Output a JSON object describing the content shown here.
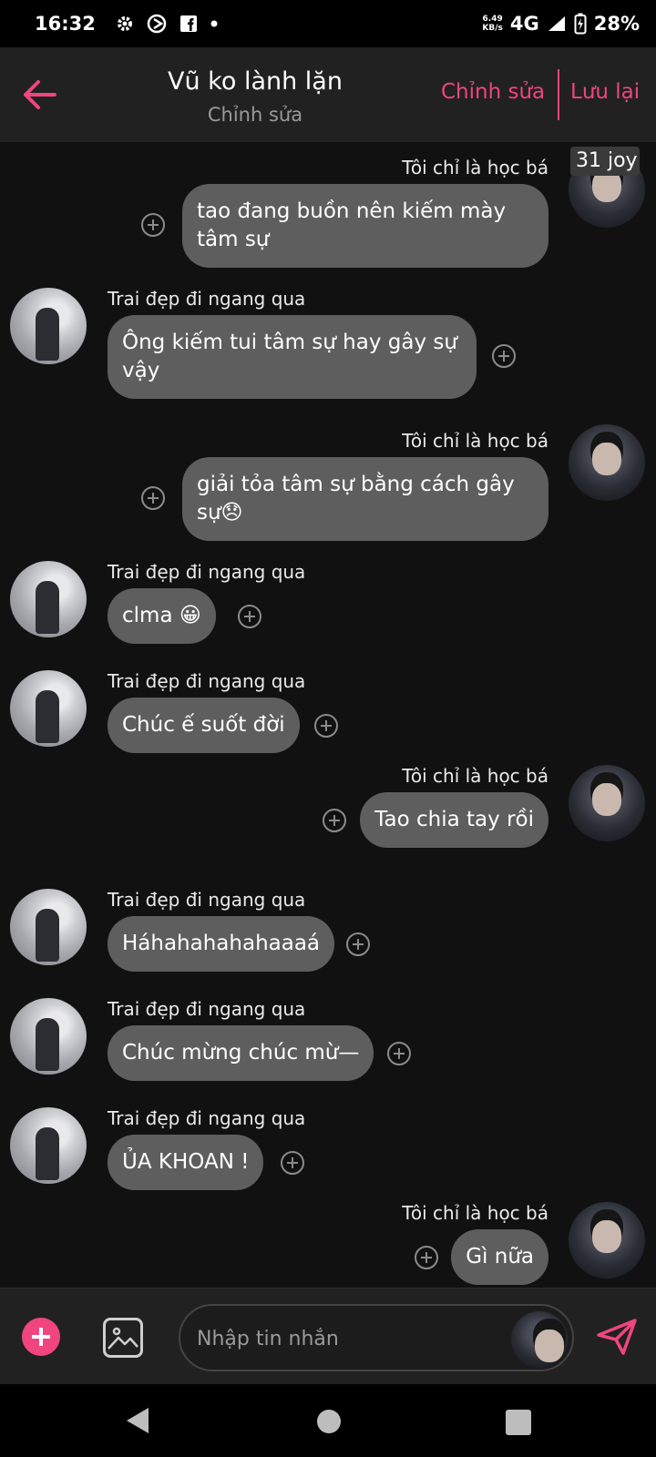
{
  "status_bar": {
    "time": "16:32",
    "network_speed_value": "6.49",
    "network_speed_unit": "KB/s",
    "network": "4G",
    "battery": "28%"
  },
  "header": {
    "title": "Vũ ko lành lặn",
    "subtitle": "Chỉnh sửa",
    "edit_label": "Chỉnh sửa",
    "save_label": "Lưu lại"
  },
  "overlay_badge": "31 joy",
  "messages": [
    {
      "side": "me",
      "sender": "Tôi chỉ là học bá",
      "lines": [
        "tao đang buồn nên kiếm mày",
        "tâm sự"
      ]
    },
    {
      "side": "them",
      "sender": "Trai đẹp đi ngang qua",
      "lines": [
        "Ông kiếm tui tâm sự hay gây sự",
        "vậy"
      ]
    },
    {
      "side": "me",
      "sender": "Tôi chỉ là học bá",
      "lines": [
        "giải tỏa tâm sự bằng cách gây",
        "sự😞"
      ]
    },
    {
      "side": "them",
      "sender": "Trai đẹp đi ngang qua",
      "lines": [
        "clma 😀"
      ]
    },
    {
      "side": "them",
      "sender": "Trai đẹp đi ngang qua",
      "lines": [
        "Chúc ế suốt đời"
      ]
    },
    {
      "side": "me",
      "sender": "Tôi chỉ là học bá",
      "lines": [
        "Tao chia tay rồi"
      ]
    },
    {
      "side": "them",
      "sender": "Trai đẹp đi ngang qua",
      "lines": [
        "Háhahahahahaaaá"
      ]
    },
    {
      "side": "them",
      "sender": "Trai đẹp đi ngang qua",
      "lines": [
        "Chúc mừng chúc mừ—"
      ]
    },
    {
      "side": "them",
      "sender": "Trai đẹp đi ngang qua",
      "lines": [
        "ỦA KHOAN !"
      ]
    },
    {
      "side": "me",
      "sender": "Tôi chỉ là học bá",
      "lines": [
        "Gì nữa"
      ]
    }
  ],
  "input": {
    "placeholder": "Nhập tin nhắn"
  },
  "colors": {
    "accent": "#f0457f",
    "bubble": "#5e5e5e",
    "background": "#111111",
    "header": "#212121"
  },
  "icons": [
    "back-arrow-icon",
    "add-reaction-icon",
    "image-icon",
    "send-icon",
    "plus-icon"
  ]
}
